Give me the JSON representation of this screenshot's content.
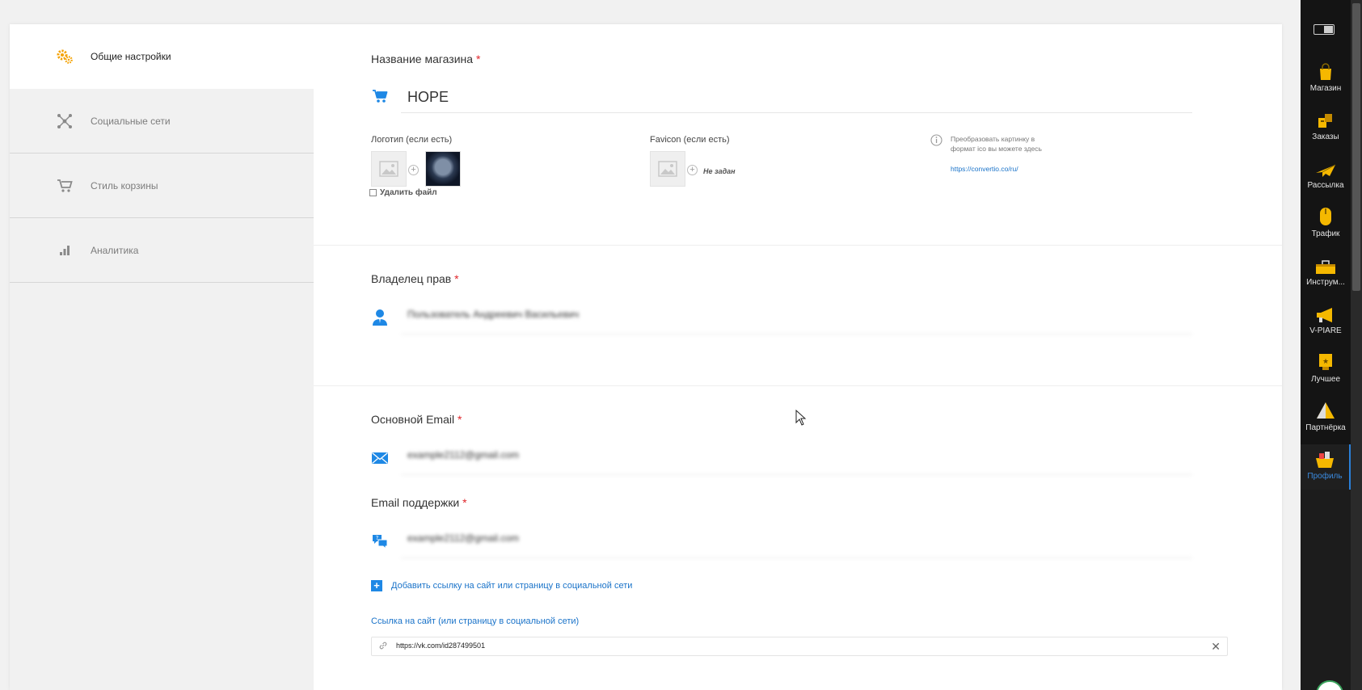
{
  "menu": {
    "items": [
      {
        "label": "Общие настройки",
        "icon": "gears-icon",
        "active": true
      },
      {
        "label": "Социальные сети",
        "icon": "network-icon",
        "active": false
      },
      {
        "label": "Стиль корзины",
        "icon": "cart-icon",
        "active": false
      },
      {
        "label": "Аналитика",
        "icon": "bar-chart-icon",
        "active": false
      }
    ]
  },
  "store": {
    "title": "Название магазина",
    "required_mark": "*",
    "name_value": "HOPE",
    "logo_label": "Логотип (если есть)",
    "delete_file_label": "Удалить файл",
    "favicon_label": "Favicon (если есть)",
    "favicon_status": "Не задан",
    "ico_hint": "Преобразовать картинку в формат ico вы можете здесь",
    "ico_link": "https://convertio.co/ru/"
  },
  "owner": {
    "title": "Владелец прав",
    "required_mark": "*",
    "value": "Пользователь Андреевич Васильевич"
  },
  "email": {
    "main_title": "Основной Email",
    "main_value": "example2112@gmail.com",
    "support_title": "Email поддержки",
    "support_value": "example2112@gmail.com",
    "required_mark": "*"
  },
  "site_link": {
    "add_label": "Добавить ссылку на сайт или страницу в социальной сети",
    "field_label": "Ссылка на сайт (или страницу в социальной сети)",
    "value": "https://vk.com/id287499501"
  },
  "appbar": {
    "items": [
      {
        "label": "Магазин",
        "icon": "shopping-bag-icon"
      },
      {
        "label": "Заказы",
        "icon": "boxes-icon"
      },
      {
        "label": "Рассылка",
        "icon": "paper-plane-icon"
      },
      {
        "label": "Трафик",
        "icon": "mouse-icon"
      },
      {
        "label": "Инструм...",
        "icon": "toolbox-icon"
      },
      {
        "label": "V-PIARE",
        "icon": "megaphone-icon"
      },
      {
        "label": "Лучшее",
        "icon": "trophy-icon"
      },
      {
        "label": "Партнёрка",
        "icon": "pyramid-icon"
      },
      {
        "label": "Профиль",
        "icon": "profile-basket-icon",
        "active": true
      }
    ]
  },
  "colors": {
    "accent": "#2a7fd8",
    "icon_blue": "#1e88e5",
    "required": "#e0262b",
    "menu_icon_active": "#f4a100",
    "appbar_bg": "#141414"
  }
}
